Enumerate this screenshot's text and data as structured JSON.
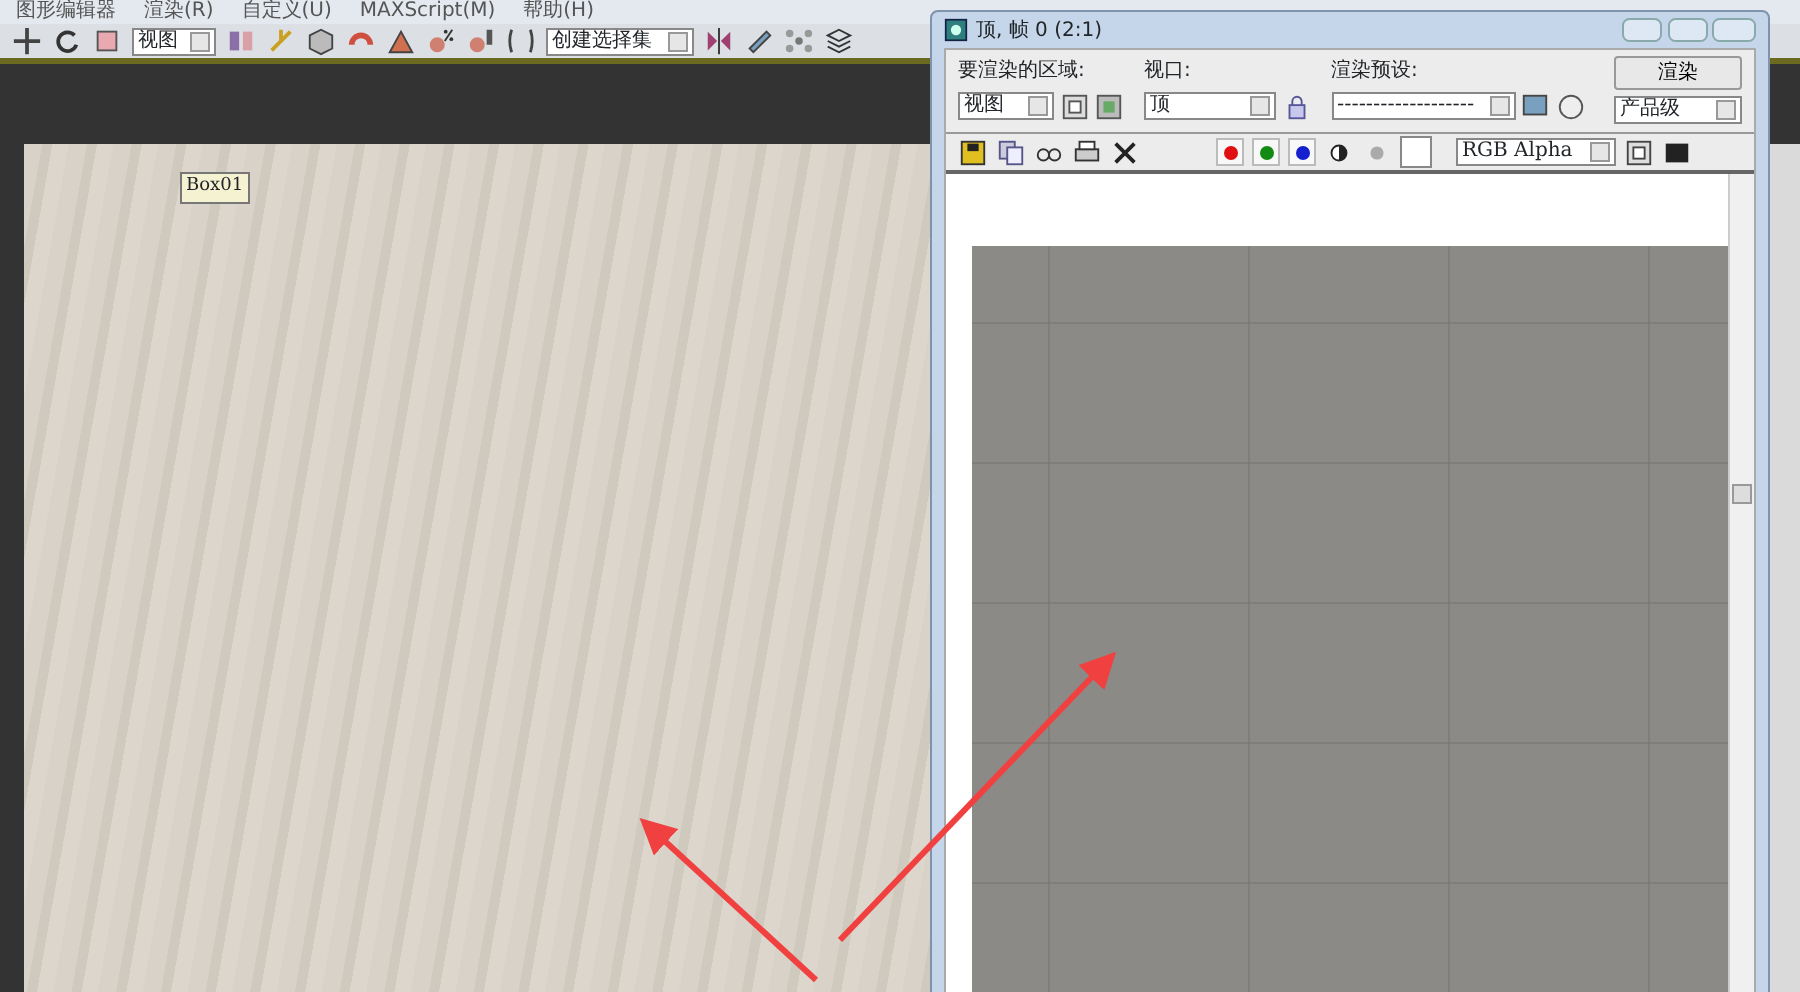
{
  "menu": [
    "图形编辑器",
    "渲染(R)",
    "自定义(U)",
    "MAXScript(M)",
    "帮助(H)"
  ],
  "toolbar": {
    "view_dropdown": "视图",
    "selection_set": "创建选择集"
  },
  "viewport": {
    "object_label": "Box01"
  },
  "render_window": {
    "title": "顶, 帧 0 (2:1)",
    "area_label": "要渲染的区域:",
    "area_value": "视图",
    "viewport_label": "视口:",
    "viewport_value": "顶",
    "preset_label": "渲染预设:",
    "preset_value": "-------------------",
    "render_button": "渲染",
    "quality_value": "产品级",
    "display_value": "RGB Alpha",
    "channels": [
      {
        "color": "#e01010",
        "on": true
      },
      {
        "color": "#138a13",
        "on": true
      },
      {
        "color": "#1420d0",
        "on": true
      }
    ]
  }
}
